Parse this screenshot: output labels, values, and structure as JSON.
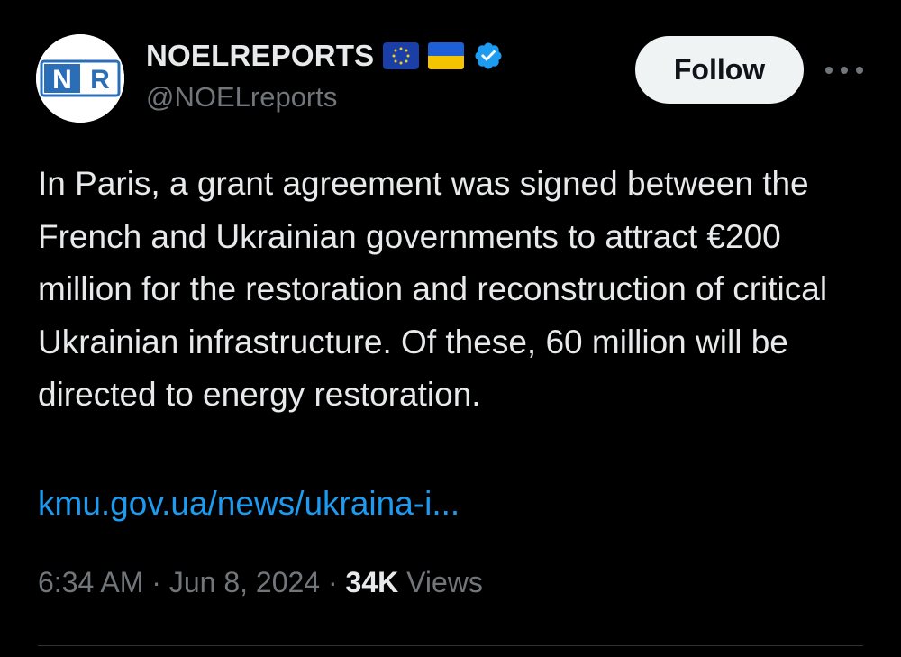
{
  "author": {
    "display_name": "NOELREPORTS",
    "handle": "@NOELreports",
    "avatar_text": "NR",
    "badges": [
      "eu-flag-icon",
      "ukraine-flag-icon",
      "verified-badge-icon"
    ]
  },
  "actions": {
    "follow_label": "Follow",
    "more_icon": "more-horizontal-icon"
  },
  "tweet": {
    "text": "In Paris, a grant agreement was signed between the French and Ukrainian governments to attract €200 million for the restoration and reconstruction of critical Ukrainian infrastructure. Of these, 60 million will be directed to energy restoration.",
    "link": "kmu.gov.ua/news/ukraina-i..."
  },
  "meta": {
    "time": "6:34 AM",
    "separator": "·",
    "date": "Jun 8, 2024",
    "views_count": "34K",
    "views_label": "Views"
  },
  "colors": {
    "background": "#000000",
    "text": "#e7e9ea",
    "secondary": "#71767b",
    "link": "#1d9bf0",
    "verified": "#1d9bf0",
    "follow_bg": "#eff3f4"
  }
}
